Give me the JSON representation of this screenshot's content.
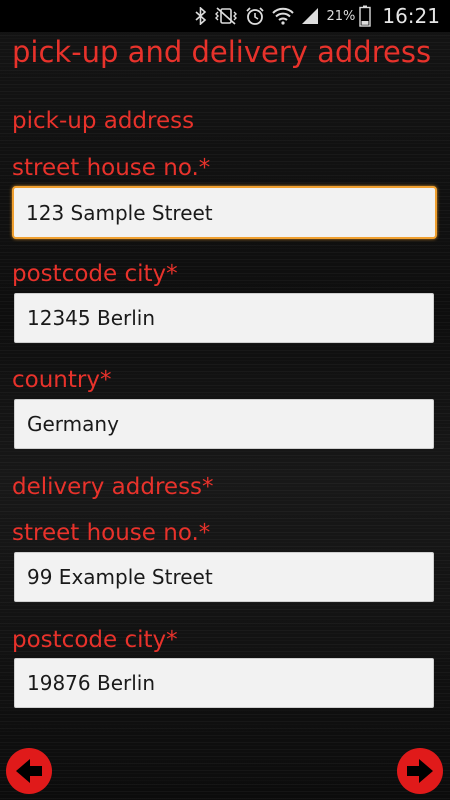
{
  "status_bar": {
    "battery_percent": "21%",
    "time": "16:21",
    "icons": [
      "bluetooth-icon",
      "vibrate-mute-icon",
      "alarm-icon",
      "wifi-icon",
      "signal-icon",
      "battery-icon"
    ]
  },
  "page": {
    "title": "pick-up and delivery address"
  },
  "pickup": {
    "header": "pick-up address",
    "street_label": "street house no.*",
    "street_value": "123 Sample Street",
    "postcode_label": "postcode city*",
    "postcode_value": "12345 Berlin",
    "country_label": "country*",
    "country_value": "Germany"
  },
  "delivery": {
    "header": "delivery address*",
    "street_label": "street house no.*",
    "street_value": "99 Example Street",
    "postcode_label": "postcode city*",
    "postcode_value": "19876 Berlin"
  },
  "nav": {
    "back_icon": "arrow-left-icon",
    "next_icon": "arrow-right-icon"
  },
  "colors": {
    "accent_red": "#e8322b",
    "focus_orange": "#f0a030",
    "nav_button_red": "#e01a1a"
  }
}
